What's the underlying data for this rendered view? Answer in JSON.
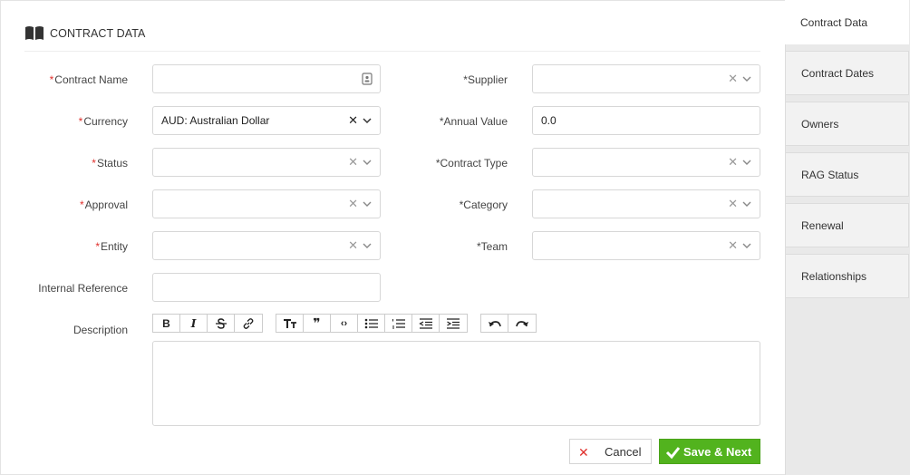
{
  "header": {
    "title": "CONTRACT DATA",
    "icon": "book-icon"
  },
  "form": {
    "contract_name": {
      "label": "Contract Name",
      "required": "*",
      "value": ""
    },
    "supplier": {
      "label": "Supplier",
      "required": "*",
      "value": ""
    },
    "currency": {
      "label": "Currency",
      "required": "*",
      "value": "AUD: Australian Dollar"
    },
    "annual_value": {
      "label": "Annual Value",
      "required": "*",
      "value": "0.0"
    },
    "status": {
      "label": "Status",
      "required": "*",
      "value": ""
    },
    "contract_type": {
      "label": "Contract Type",
      "required": "*",
      "value": ""
    },
    "approval": {
      "label": "Approval",
      "required": "*",
      "value": ""
    },
    "category": {
      "label": "Category",
      "required": "*",
      "value": ""
    },
    "entity": {
      "label": "Entity",
      "required": "*",
      "value": ""
    },
    "team": {
      "label": "Team",
      "required": "*",
      "value": ""
    },
    "internal_reference": {
      "label": "Internal Reference",
      "value": ""
    },
    "description": {
      "label": "Description",
      "value": ""
    }
  },
  "editor_toolbar": {
    "bold": "B",
    "italic": "I",
    "quote": "❞",
    "code": "‹›"
  },
  "buttons": {
    "cancel": "Cancel",
    "save_next": "Save & Next"
  },
  "tabs": [
    {
      "label": "Contract Data",
      "active": true
    },
    {
      "label": "Contract Dates"
    },
    {
      "label": "Owners"
    },
    {
      "label": "RAG Status"
    },
    {
      "label": "Renewal"
    },
    {
      "label": "Relationships"
    }
  ],
  "colors": {
    "required": "#e0312d",
    "save_button": "#52b31e",
    "sidebar_bg": "#e9e9e9"
  }
}
